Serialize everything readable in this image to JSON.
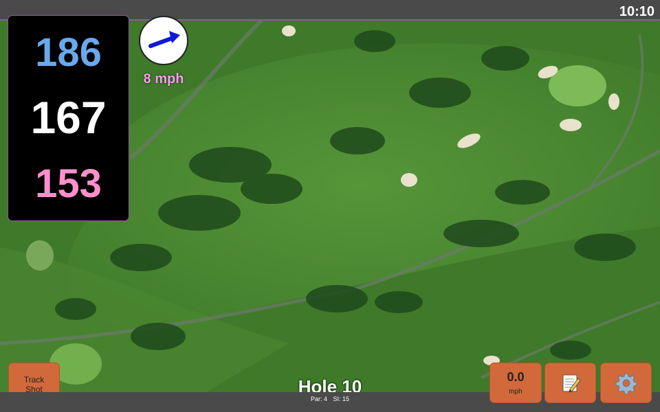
{
  "status_bar": {
    "time": "10:10"
  },
  "distances": {
    "back": "186",
    "middle": "167",
    "front": "153",
    "colors": {
      "back": "#6aa8ec",
      "middle": "#ffffff",
      "front": "#ff8fcc"
    }
  },
  "wind": {
    "speed": "8 mph",
    "speed_color": "#ff9cf0",
    "arrow_color": "#1019d6"
  },
  "hole": {
    "title": "Hole 10",
    "par": "Par: 4",
    "stroke_index": "SI: 15"
  },
  "buttons": {
    "track_shot_line1": "Track",
    "track_shot_line2": "Shot",
    "speed_value": "0.0",
    "speed_unit": "mph",
    "notes_icon": "notepad-icon",
    "settings_icon": "gear-icon"
  },
  "colors": {
    "button_bg": "#d2693a",
    "bar_bg": "#4a4a4a"
  }
}
